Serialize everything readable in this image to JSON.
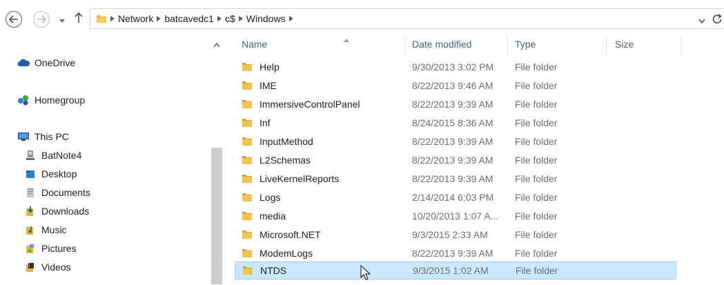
{
  "address_bar": {
    "breadcrumbs": [
      "Network",
      "batcavedc1",
      "c$",
      "Windows"
    ]
  },
  "navigation_pane": {
    "items": [
      {
        "label": "OneDrive",
        "icon": "onedrive-cloud-icon",
        "level": 0
      },
      {
        "label": "Homegroup",
        "icon": "homegroup-icon",
        "level": 0
      },
      {
        "label": "This PC",
        "icon": "this-pc-icon",
        "level": 0
      },
      {
        "label": "BatNote4",
        "icon": "network-computer-icon",
        "level": 1
      },
      {
        "label": "Desktop",
        "icon": "desktop-folder-icon",
        "level": 1
      },
      {
        "label": "Documents",
        "icon": "documents-folder-icon",
        "level": 1
      },
      {
        "label": "Downloads",
        "icon": "downloads-folder-icon",
        "level": 1
      },
      {
        "label": "Music",
        "icon": "music-folder-icon",
        "level": 1
      },
      {
        "label": "Pictures",
        "icon": "pictures-folder-icon",
        "level": 1
      },
      {
        "label": "Videos",
        "icon": "videos-folder-icon",
        "level": 1
      }
    ]
  },
  "file_list": {
    "columns": [
      "Name",
      "Date modified",
      "Type",
      "Size"
    ],
    "sorted_by": "Name",
    "rows": [
      {
        "name": "Help",
        "date": "9/30/2013 3:02 PM",
        "type": "File folder"
      },
      {
        "name": "IME",
        "date": "8/22/2013 9:46 AM",
        "type": "File folder"
      },
      {
        "name": "ImmersiveControlPanel",
        "date": "8/22/2013 9:39 AM",
        "type": "File folder"
      },
      {
        "name": "Inf",
        "date": "8/24/2015 8:36 AM",
        "type": "File folder"
      },
      {
        "name": "InputMethod",
        "date": "8/22/2013 9:39 AM",
        "type": "File folder"
      },
      {
        "name": "L2Schemas",
        "date": "8/22/2013 9:39 AM",
        "type": "File folder"
      },
      {
        "name": "LiveKernelReports",
        "date": "8/22/2013 9:39 AM",
        "type": "File folder"
      },
      {
        "name": "Logs",
        "date": "2/14/2014 6:03 PM",
        "type": "File folder"
      },
      {
        "name": "media",
        "date": "10/20/2013 1:07 A...",
        "type": "File folder"
      },
      {
        "name": "Microsoft.NET",
        "date": "9/3/2015 2:33 AM",
        "type": "File folder"
      },
      {
        "name": "ModemLogs",
        "date": "8/22/2013 9:39 AM",
        "type": "File folder"
      },
      {
        "name": "NTDS",
        "date": "9/3/2015 1:02 AM",
        "type": "File folder",
        "selected": true
      }
    ]
  },
  "colors": {
    "selection_bg": "#cce8ff",
    "selection_border": "#99d1ff",
    "folder_yellow": "#e8b537",
    "header_text": "#4c607a"
  }
}
